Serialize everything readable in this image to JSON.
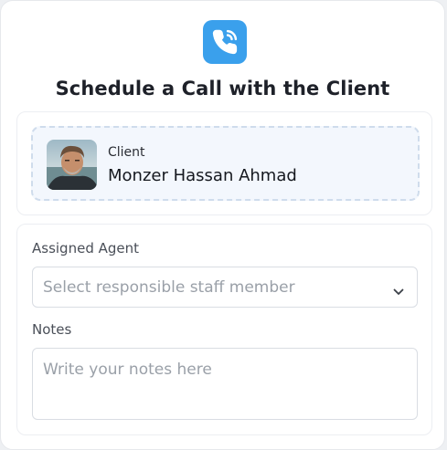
{
  "dialog": {
    "title": "Schedule a Call with the Client",
    "icon": "phone-call-icon",
    "accent_color": "#3aa0ec"
  },
  "client": {
    "label": "Client",
    "name": "Monzer Hassan Ahmad"
  },
  "form": {
    "agent": {
      "label": "Assigned Agent",
      "placeholder": "Select responsible staff member",
      "icon": "chevron-down-icon"
    },
    "notes": {
      "label": "Notes",
      "placeholder": "Write your notes here"
    }
  }
}
